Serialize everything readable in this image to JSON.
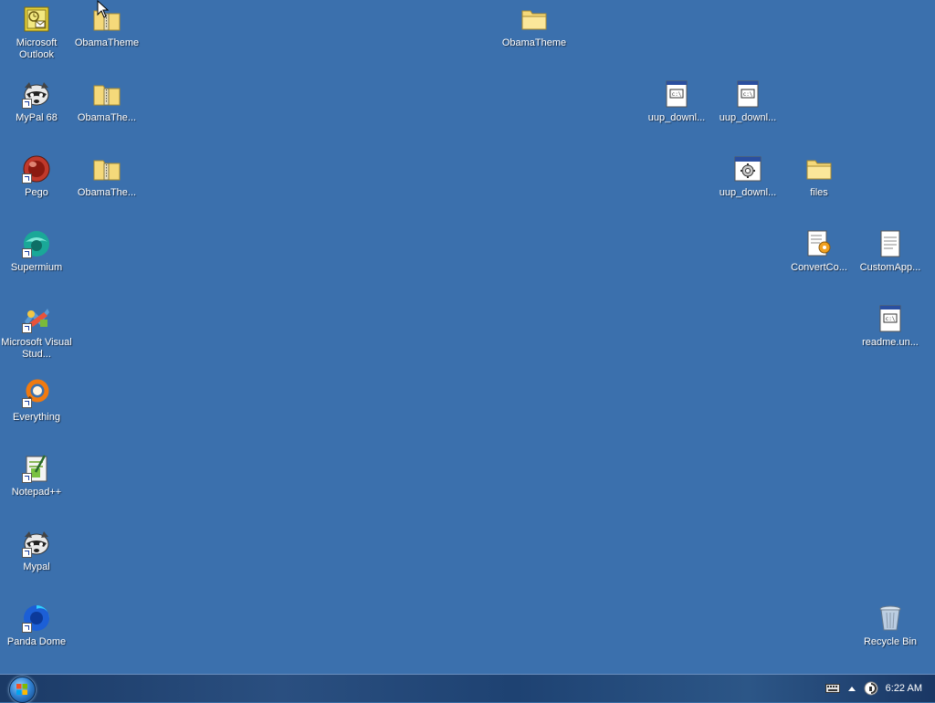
{
  "desktop": {
    "icons": [
      {
        "label": "Microsoft Outlook",
        "type": "outlook",
        "shortcut": false
      },
      {
        "label": "ObamaTheme",
        "type": "zip-folder",
        "shortcut": false
      },
      {
        "label": "ObamaTheme",
        "type": "folder",
        "shortcut": false
      },
      {
        "label": "MyPal 68",
        "type": "raccoon",
        "shortcut": true
      },
      {
        "label": "ObamaThe...",
        "type": "zip-folder",
        "shortcut": false
      },
      {
        "label": "uup_downl...",
        "type": "text-doc",
        "shortcut": false
      },
      {
        "label": "uup_downl...",
        "type": "text-doc",
        "shortcut": false
      },
      {
        "label": "Pego",
        "type": "pego",
        "shortcut": true
      },
      {
        "label": "ObamaThe...",
        "type": "zip-folder",
        "shortcut": false
      },
      {
        "label": "uup_downl...",
        "type": "gear-window",
        "shortcut": false
      },
      {
        "label": "files",
        "type": "folder",
        "shortcut": false
      },
      {
        "label": "Supermium",
        "type": "supermium",
        "shortcut": true
      },
      {
        "label": "ConvertCo...",
        "type": "script-doc",
        "shortcut": false
      },
      {
        "label": "CustomApp...",
        "type": "notepad-doc",
        "shortcut": false
      },
      {
        "label": "Microsoft Visual Stud...",
        "type": "vstudio",
        "shortcut": true
      },
      {
        "label": "readme.un...",
        "type": "text-doc",
        "shortcut": false
      },
      {
        "label": "Everything",
        "type": "everything",
        "shortcut": true
      },
      {
        "label": "Notepad++",
        "type": "notepadpp",
        "shortcut": true
      },
      {
        "label": "Mypal",
        "type": "raccoon",
        "shortcut": true
      },
      {
        "label": "Panda Dome",
        "type": "panda",
        "shortcut": true
      },
      {
        "label": "Recycle Bin",
        "type": "recycle-bin",
        "shortcut": false
      }
    ]
  },
  "taskbar": {
    "clock": "6:22 AM",
    "tray_icons": [
      "keyboard-icon",
      "show-hidden-icons-arrow-icon",
      "network-icon"
    ]
  },
  "colors": {
    "desktop": "#3b70ad",
    "taskbar": "#1e4272"
  }
}
